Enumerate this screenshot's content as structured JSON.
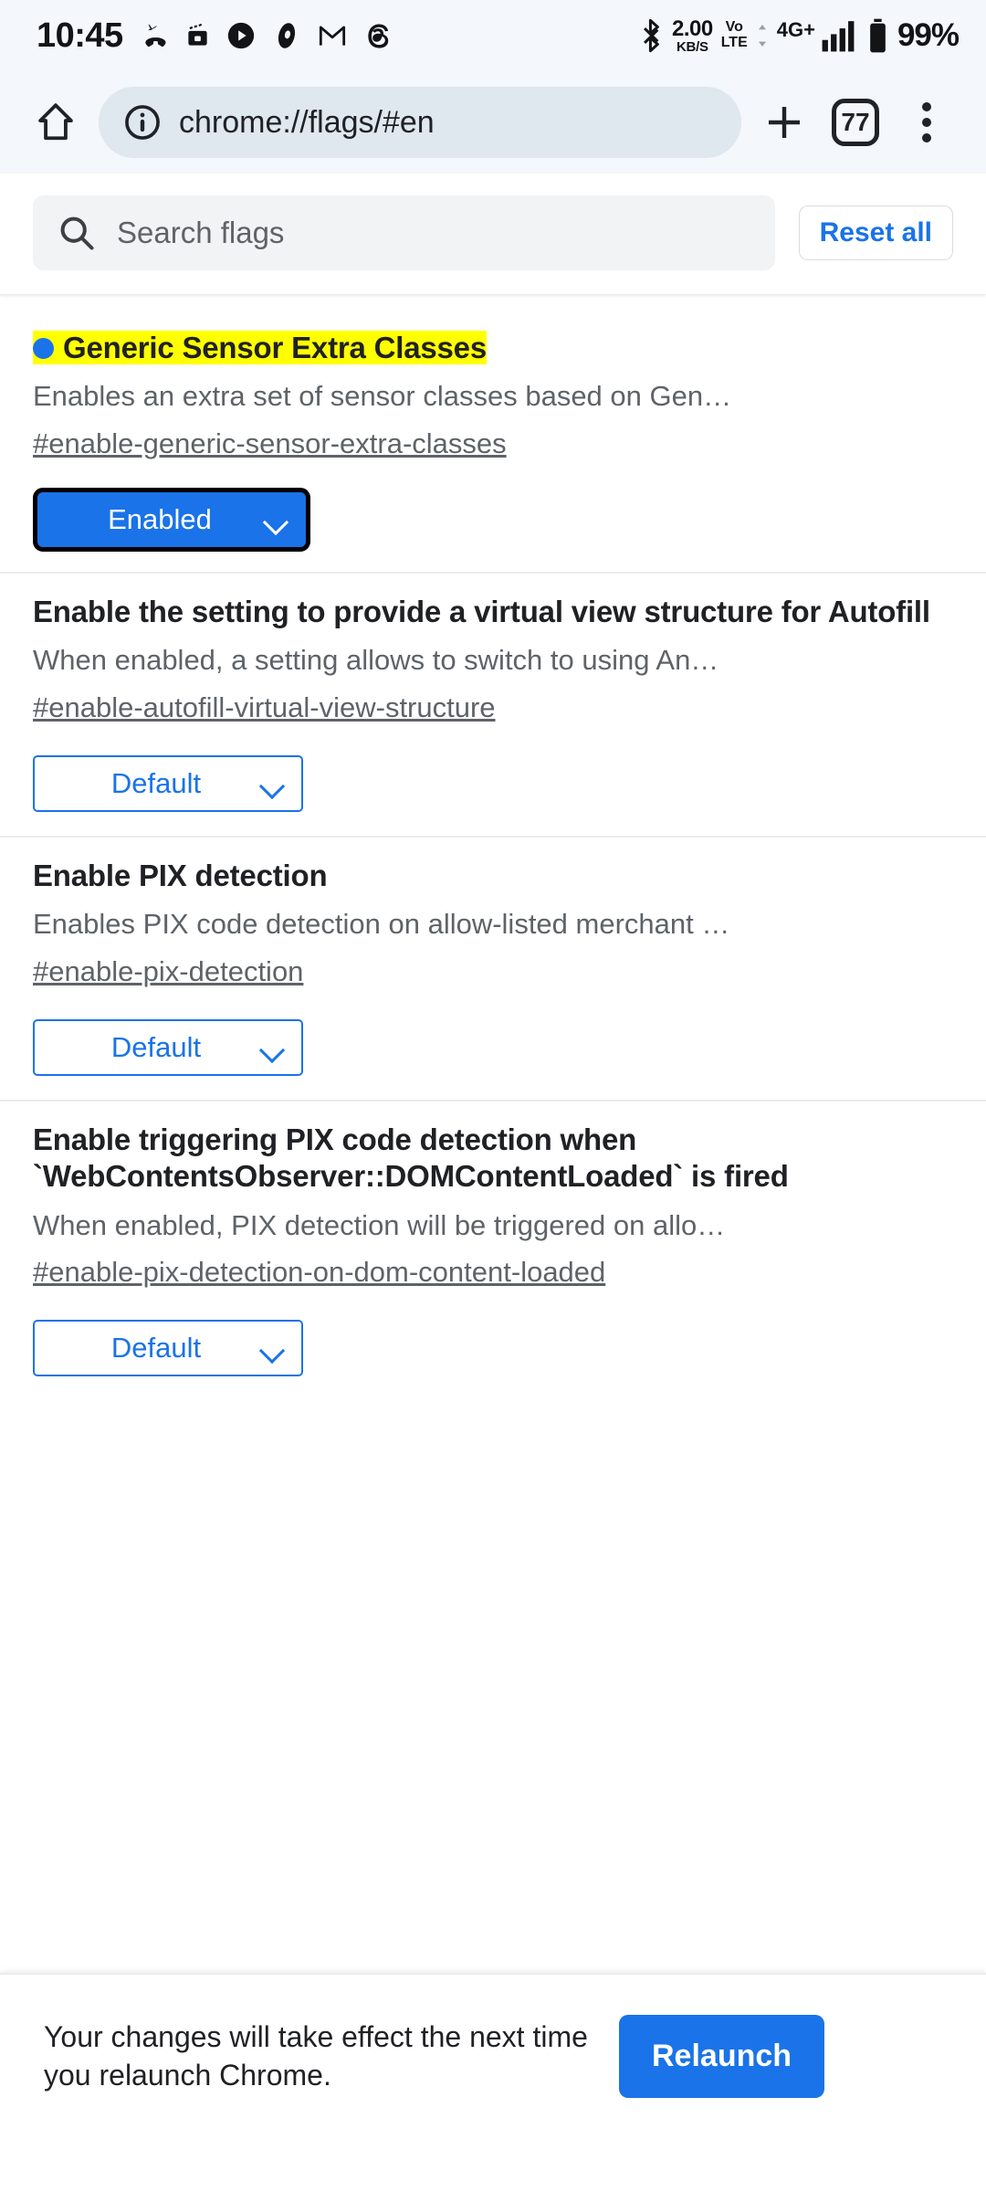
{
  "status_bar": {
    "time": "10:45",
    "left_icons": [
      "call-end-icon",
      "screen-record-icon",
      "play-circle-icon",
      "opera-icon",
      "gmail-icon",
      "threads-icon"
    ],
    "bluetooth_icon": "bluetooth-icon",
    "net_speed_value": "2.00",
    "net_speed_unit": "KB/S",
    "volte_top": "Vo",
    "volte_bottom": "LTE",
    "network_type": "4G+",
    "signal_icon": "signal-bars-icon",
    "battery_icon": "battery-icon",
    "battery_percent": "99%"
  },
  "toolbar": {
    "home_icon": "home-icon",
    "info_icon": "info-circle-icon",
    "url": "chrome://flags/#en",
    "new_tab_icon": "plus-icon",
    "tab_count": "77",
    "menu_icon": "kebab-menu-icon"
  },
  "flags_header": {
    "search_icon": "search-icon",
    "search_value": "",
    "search_placeholder": "Search flags",
    "reset_all_label": "Reset all"
  },
  "flags": [
    {
      "title": "Generic Sensor Extra Classes",
      "highlighted": true,
      "has_dot": true,
      "description": "Enables an extra set of sensor classes based on Gen…",
      "permalink": "#enable-generic-sensor-extra-classes",
      "select_value": "Enabled",
      "select_state": "enabled"
    },
    {
      "title": "Enable the setting to provide a virtual view structure for Autofill",
      "highlighted": false,
      "has_dot": false,
      "description": "When enabled, a setting allows to switch to using An…",
      "permalink": "#enable-autofill-virtual-view-structure",
      "select_value": "Default",
      "select_state": "default"
    },
    {
      "title": "Enable PIX detection",
      "highlighted": false,
      "has_dot": false,
      "description": "Enables PIX code detection on allow-listed merchant …",
      "permalink": "#enable-pix-detection",
      "select_value": "Default",
      "select_state": "default"
    },
    {
      "title": "Enable triggering PIX code detection when `WebContentsObserver::DOMContentLoaded` is fired",
      "highlighted": false,
      "has_dot": false,
      "description": "When enabled, PIX detection will be triggered on allo…",
      "permalink": "#enable-pix-detection-on-dom-content-loaded",
      "select_value": "Default",
      "select_state": "default"
    }
  ],
  "relaunch_bar": {
    "message": "Your changes will take effect the next time you relaunch Chrome.",
    "button_label": "Relaunch"
  },
  "colors": {
    "accent_blue": "#1a73e8",
    "highlight_yellow": "#ffff00",
    "status_bg": "#f4f7fb",
    "omnibox_bg": "#dfe7ef",
    "search_bg": "#f1f3f4",
    "text_secondary": "#5f6368"
  }
}
